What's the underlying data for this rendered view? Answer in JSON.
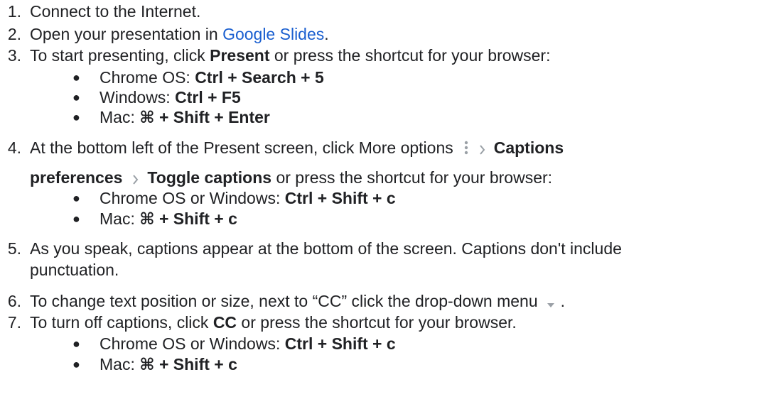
{
  "steps": [
    {
      "num": "1.",
      "text": "Connect to the Internet."
    },
    {
      "num": "2.",
      "pre": "Open your presentation in ",
      "link": "Google Slides",
      "post": "."
    },
    {
      "num": "3.",
      "pre": "To start presenting, click ",
      "bold": "Present",
      "post": " or press the shortcut for your browser:",
      "bullets": [
        {
          "label": "Chrome OS: ",
          "keys": "Ctrl + Search + 5"
        },
        {
          "label": "Windows: ",
          "keys": "Ctrl + F5"
        },
        {
          "label": "Mac: ",
          "keys": "⌘ + Shift + Enter"
        }
      ]
    },
    {
      "num": "4.",
      "pre": "At the bottom left of the Present screen, click More options",
      "bold1": "Captions",
      "bold2": "preferences",
      "bold3": "Toggle captions",
      "post": " or press the shortcut for your browser:",
      "bullets": [
        {
          "label": "Chrome OS or Windows: ",
          "keys": "Ctrl + Shift + c"
        },
        {
          "label": "Mac: ",
          "keys": "⌘ + Shift + c"
        }
      ]
    },
    {
      "num": "5.",
      "line1": "As you speak, captions appear at the bottom of the screen. Captions don't include",
      "line2": "punctuation."
    },
    {
      "num": "6.",
      "pre": "To change text position or size, next to “CC” click the drop-down menu",
      "post": "."
    },
    {
      "num": "7.",
      "pre": "To turn off captions, click ",
      "bold": "CC",
      "post": " or press the shortcut for your browser.",
      "bullets": [
        {
          "label": "Chrome OS or Windows: ",
          "keys": "Ctrl + Shift + c"
        },
        {
          "label": "Mac: ",
          "keys": "⌘ + Shift + c"
        }
      ]
    }
  ],
  "icons": {
    "more_options": "more-vert-icon",
    "chevron": "chevron-right-icon",
    "dropdown": "dropdown-arrow-icon"
  }
}
